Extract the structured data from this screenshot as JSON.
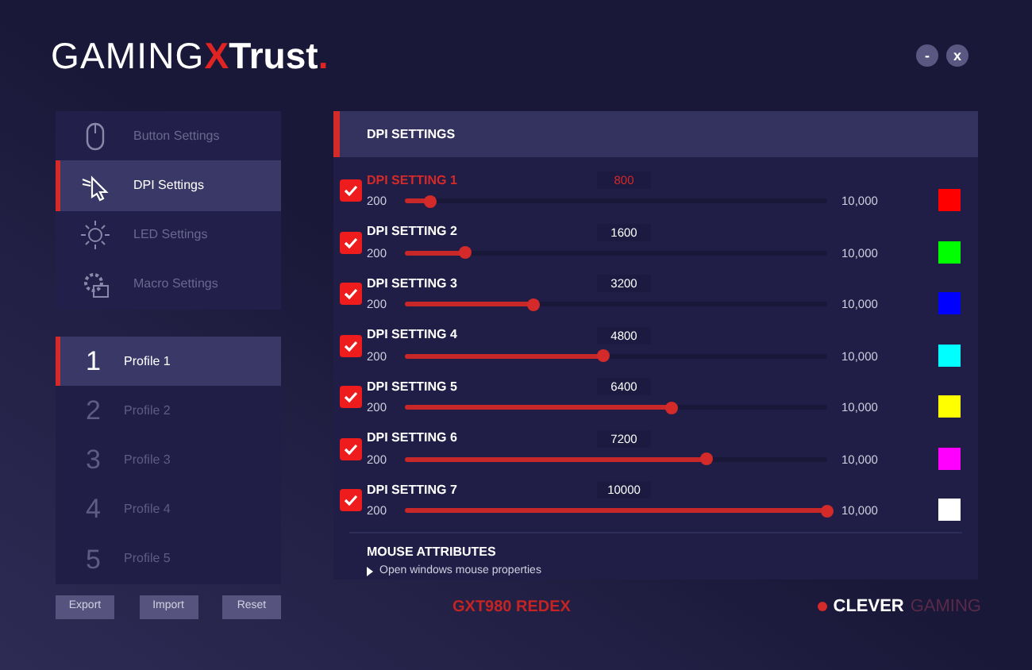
{
  "logo": {
    "part_1": "GAMING",
    "part_2": "X",
    "part_3": "Trust",
    "part_4": "."
  },
  "window_buttons": [
    "-",
    "x"
  ],
  "menu": [
    {
      "label": "Button Settings",
      "kind": "mouse",
      "selected": false
    },
    {
      "label": "DPI Settings",
      "kind": "cursor",
      "selected": true
    },
    {
      "label": "LED Settings",
      "kind": "sun",
      "selected": false
    },
    {
      "label": "Macro Settings",
      "kind": "gear",
      "selected": false
    }
  ],
  "profiles": [
    {
      "number": "1",
      "label": "Profile 1",
      "selected": true
    },
    {
      "number": "2",
      "label": "Profile 2",
      "selected": false
    },
    {
      "number": "3",
      "label": "Profile 3",
      "selected": false
    },
    {
      "number": "4",
      "label": "Profile 4",
      "selected": false
    },
    {
      "number": "5",
      "label": "Profile 5",
      "selected": false
    }
  ],
  "profile_buttons": [
    "Export",
    "Import",
    "Reset"
  ],
  "panel": {
    "title": "DPI SETTINGS",
    "settings": [
      {
        "name": "DPI SETTING 1",
        "checked": true,
        "selected": true,
        "value": "800",
        "min": "200",
        "max": "10,000",
        "level": 0.061,
        "color": "#ff0000"
      },
      {
        "name": "DPI SETTING 2",
        "checked": true,
        "selected": false,
        "value": "1600",
        "min": "200",
        "max": "10,000",
        "level": 0.143,
        "color": "#00ff00"
      },
      {
        "name": "DPI SETTING 3",
        "checked": true,
        "selected": false,
        "value": "3200",
        "min": "200",
        "max": "10,000",
        "level": 0.306,
        "color": "#0000ff"
      },
      {
        "name": "DPI SETTING 4",
        "checked": true,
        "selected": false,
        "value": "4800",
        "min": "200",
        "max": "10,000",
        "level": 0.469,
        "color": "#00ffff"
      },
      {
        "name": "DPI SETTING 5",
        "checked": true,
        "selected": false,
        "value": "6400",
        "min": "200",
        "max": "10,000",
        "level": 0.633,
        "color": "#ffff00"
      },
      {
        "name": "DPI SETTING 6",
        "checked": true,
        "selected": false,
        "value": "7200",
        "min": "200",
        "max": "10,000",
        "level": 0.714,
        "color": "#ff00ff"
      },
      {
        "name": "DPI SETTING 7",
        "checked": true,
        "selected": false,
        "value": "10000",
        "min": "200",
        "max": "10,000",
        "level": 1,
        "color": "#ffffff"
      }
    ],
    "attributes_title": "MOUSE ATTRIBUTES",
    "attributes_link": "Open windows mouse properties"
  },
  "footer": {
    "model": "GXT980 REDEX",
    "brand_1": "CLEVER",
    "brand_2": "GAMING"
  }
}
